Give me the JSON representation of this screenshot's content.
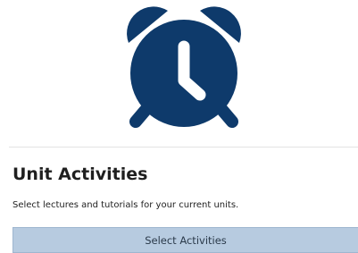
{
  "card": {
    "icon": "alarm-clock-icon",
    "title": "Unit Activities",
    "description": "Select lectures and tutorials for your current units.",
    "button_label": "Select Activities"
  },
  "colors": {
    "icon": "#0e3a6b",
    "button_bg": "#b7cbe0",
    "button_border": "#9fb6cf",
    "title_text": "#1f1f1f"
  }
}
